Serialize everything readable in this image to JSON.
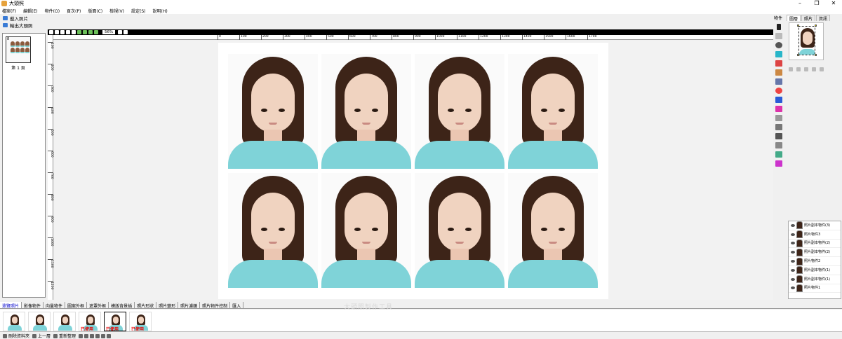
{
  "window": {
    "title": "大頭照"
  },
  "menu": [
    "檔案(F)",
    "編輯(E)",
    "物件(O)",
    "頁次(P)",
    "版面(C)",
    "檢視(V)",
    "設定(S)",
    "說明(H)"
  ],
  "left_panel": {
    "load_photo": "載入照片",
    "export_photo": "輸出大頭照",
    "page_number": "8",
    "page_label": "第 1 頁"
  },
  "editor": {
    "zoom": "56%"
  },
  "ruler": {
    "h_ticks": [
      "0",
      "100",
      "200",
      "300",
      "400",
      "500",
      "600",
      "700",
      "800",
      "900",
      "1000",
      "1100",
      "1200",
      "1300",
      "1400",
      "1500",
      "1600",
      "1700"
    ],
    "v_ticks": [
      "100",
      "200",
      "300",
      "400",
      "500",
      "600",
      "700",
      "800",
      "900",
      "1000",
      "1100",
      "1200"
    ]
  },
  "tool_column": {
    "tab": "物件"
  },
  "right_panel": {
    "tabs": [
      "圖層",
      "照片",
      "資訊"
    ],
    "layers": [
      "照片副本物件(3)",
      "照片物件3",
      "照片副本物件(2)",
      "照片副本物件(2)",
      "照片物件2",
      "照片副本物件(1)",
      "照片副本物件(1)",
      "照片物件1"
    ]
  },
  "bottom_tabs": [
    "瀏覽照片",
    "影像物件",
    "向量物件",
    "圖案外框",
    "遮罩外框",
    "模版背景插",
    "照片形狀",
    "照片變形",
    "照片濾鏡",
    "照片物件控制",
    "匯入"
  ],
  "watermark": "大頭照製作工具",
  "thumbnails": [
    {
      "used": ""
    },
    {
      "used": ""
    },
    {
      "used": ""
    },
    {
      "used": "已使用"
    },
    {
      "used": "已使用"
    },
    {
      "used": "已使用"
    }
  ],
  "status": {
    "delete": "刪除資料夾",
    "prev": "上一層",
    "refresh": "重新整理"
  },
  "colors": {
    "shirt": "#7fd3d8",
    "hair": "#3d2418",
    "skin": "#f0d3c0"
  }
}
